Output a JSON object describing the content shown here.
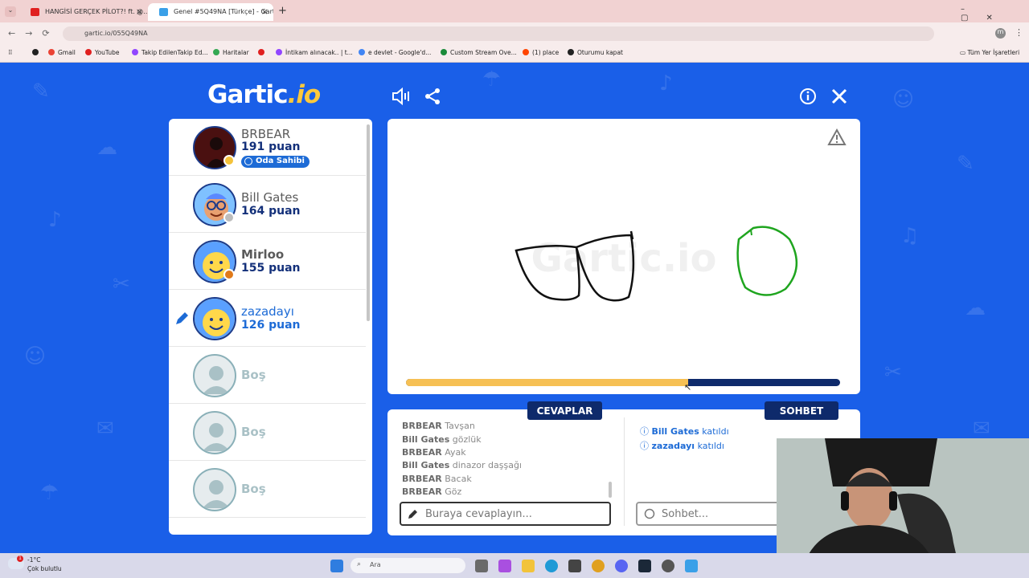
{
  "browser": {
    "tabs": [
      {
        "title": "HANGİSİ GERÇEK PİLOT?! ft. @...",
        "active": false
      },
      {
        "title": "Genel #5Q49NA [Türkçe] - Gart...",
        "active": true
      }
    ],
    "new_tab_label": "+",
    "url": "gartic.io/055Q49NA",
    "bookmarks": [
      "Gmail",
      "YouTube",
      "Takip EdilenTakip Ed...",
      "Haritalar",
      "İntikam alınacak.. | t...",
      "e devlet - Google'd...",
      "Custom Stream Ove...",
      "(1) place",
      "Oturumu kapat"
    ],
    "all_bookmarks": "Tüm Yer İşaretleri",
    "profile_initial": "m"
  },
  "game": {
    "logo": "Gartic",
    "logo_suffix": ".io",
    "players": [
      {
        "name": "BRBEAR",
        "points": "191 puan",
        "badge": "Oda Sahibi",
        "status_color": "#f4c23a",
        "highlight": false,
        "drawing": false
      },
      {
        "name": "Bill Gates",
        "points": "164 puan",
        "status_color": "#bdbdbd",
        "highlight": false,
        "drawing": false
      },
      {
        "name": "Mirloo",
        "points": "155 puan",
        "status_color": "#e07a1a",
        "highlight": false,
        "drawing": false
      },
      {
        "name": "zazadayı",
        "points": "126 puan",
        "status_color": null,
        "highlight": true,
        "drawing": true
      },
      {
        "name": "Boş",
        "points": "",
        "empty": true
      },
      {
        "name": "Boş",
        "points": "",
        "empty": true
      },
      {
        "name": "Boş",
        "points": "",
        "empty": true
      }
    ],
    "timer_fraction": 0.65,
    "answers_tab": "CEVAPLAR",
    "chat_tab": "SOHBET",
    "answers": [
      {
        "user": "BRBEAR",
        "text": "Tavşan"
      },
      {
        "user": "Bill Gates",
        "text": "gözlük"
      },
      {
        "user": "BRBEAR",
        "text": "Ayak"
      },
      {
        "user": "Bill Gates",
        "text": "dinazor daşşağı"
      },
      {
        "user": "BRBEAR",
        "text": "Bacak"
      },
      {
        "user": "BRBEAR",
        "text": "Göz"
      }
    ],
    "chat": [
      {
        "user": "Bill Gates",
        "text": "katıldı"
      },
      {
        "user": "zazadayı",
        "text": "katıldı"
      }
    ],
    "answer_placeholder": "Buraya cevaplayın...",
    "chat_placeholder": "Sohbet..."
  },
  "taskbar": {
    "weather_temp": "-1°C",
    "weather_desc": "Çok bulutlu",
    "search_placeholder": "Ara",
    "notification_count": "1"
  }
}
